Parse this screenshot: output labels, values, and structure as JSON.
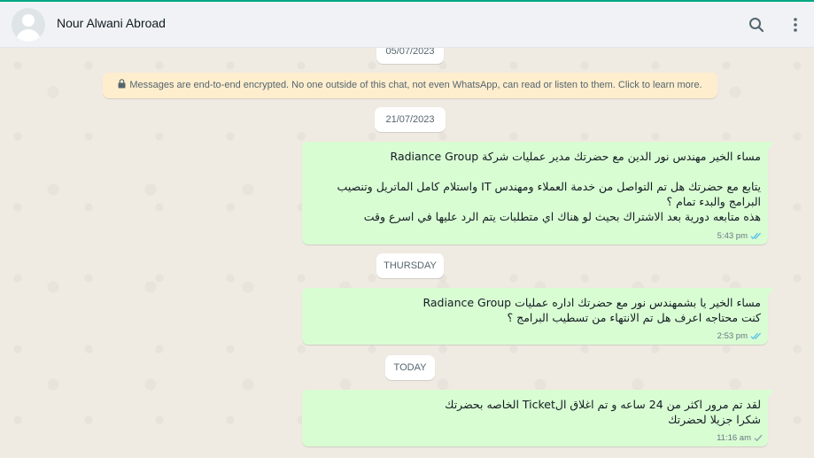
{
  "header": {
    "contact_name": "Nour Alwani Abroad"
  },
  "chat": {
    "date_top": "05/07/2023",
    "encryption_notice": "Messages are end-to-end encrypted. No one outside of this chat, not even WhatsApp, can read or listen to them. Click to learn more.",
    "date_1": "21/07/2023",
    "date_2": "THURSDAY",
    "date_3": "TODAY",
    "messages": [
      {
        "text": "مساء الخير مهندس نور الدين مع حضرتك مدير عمليات شركة Radiance Group\n\nيتابع مع حضرتك هل تم التواصل من خدمة العملاء ومهندس IT واستلام كامل الماتريل وتنصيب البرامج والبدء تمام ؟\nهذه متابعه دورية بعد الاشتراك بحيث لو هناك اي متطلبات يتم الرد عليها في اسرع وقت",
        "time": "5:43 pm",
        "status": "read"
      },
      {
        "text": "مساء الخير يا بشمهندس نور مع حضرتك اداره عمليات Radiance Group\nكنت محتاجه اعرف هل تم الانتهاء من تسطيب البرامج ؟",
        "time": "2:53 pm",
        "status": "read"
      },
      {
        "text": "لقد تم مرور اكثر من 24 ساعه و تم اغلاق الTicket الخاصه بحضرتك\nشكرا جزيلا لحضرتك",
        "time": "11:16 am",
        "status": "sent"
      }
    ]
  },
  "colors": {
    "accent": "#00a884",
    "outgoing_bubble": "#d9fdd3",
    "read_tick": "#53bdeb",
    "sent_tick": "#8696a0"
  }
}
